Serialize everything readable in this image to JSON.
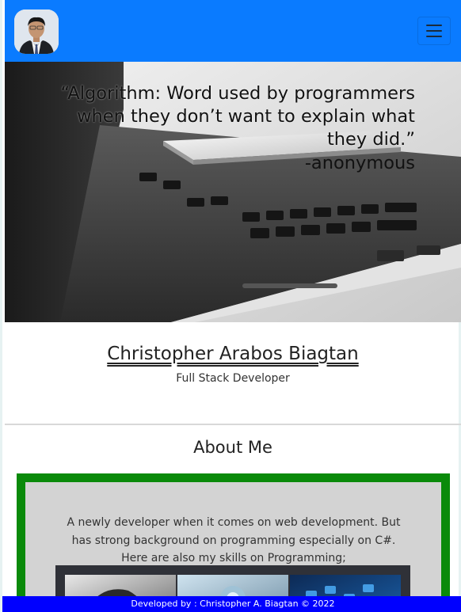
{
  "navbar": {
    "avatar_icon": "profile-photo",
    "menu_icon": "hamburger-menu-icon"
  },
  "hero": {
    "quote": "“Algorithm: Word used by programmers when they don’t want to explain what they did.”",
    "author": "-anonymous"
  },
  "profile": {
    "name": "Christopher Arabos Biagtan",
    "role": "Full Stack Developer"
  },
  "about": {
    "title": "About Me",
    "text": "A newly developer when it comes on web development. But has strong background on programming especially on C#. Here are also my skills on Programming;"
  },
  "footer": {
    "text": "Developed by : Christopher A. Biagtan © 2022"
  },
  "colors": {
    "navbar": "#0a7bff",
    "about_border": "#0a8a0a",
    "footer": "#0000ff"
  }
}
